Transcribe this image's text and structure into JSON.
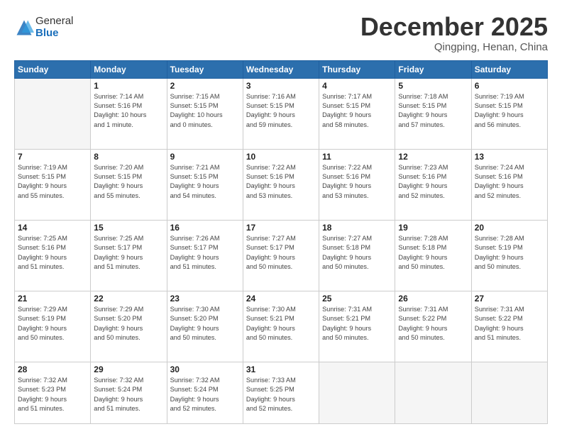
{
  "logo": {
    "general": "General",
    "blue": "Blue"
  },
  "header": {
    "month": "December 2025",
    "location": "Qingping, Henan, China"
  },
  "weekdays": [
    "Sunday",
    "Monday",
    "Tuesday",
    "Wednesday",
    "Thursday",
    "Friday",
    "Saturday"
  ],
  "weeks": [
    [
      {
        "day": "",
        "info": ""
      },
      {
        "day": "1",
        "info": "Sunrise: 7:14 AM\nSunset: 5:16 PM\nDaylight: 10 hours\nand 1 minute."
      },
      {
        "day": "2",
        "info": "Sunrise: 7:15 AM\nSunset: 5:15 PM\nDaylight: 10 hours\nand 0 minutes."
      },
      {
        "day": "3",
        "info": "Sunrise: 7:16 AM\nSunset: 5:15 PM\nDaylight: 9 hours\nand 59 minutes."
      },
      {
        "day": "4",
        "info": "Sunrise: 7:17 AM\nSunset: 5:15 PM\nDaylight: 9 hours\nand 58 minutes."
      },
      {
        "day": "5",
        "info": "Sunrise: 7:18 AM\nSunset: 5:15 PM\nDaylight: 9 hours\nand 57 minutes."
      },
      {
        "day": "6",
        "info": "Sunrise: 7:19 AM\nSunset: 5:15 PM\nDaylight: 9 hours\nand 56 minutes."
      }
    ],
    [
      {
        "day": "7",
        "info": "Sunrise: 7:19 AM\nSunset: 5:15 PM\nDaylight: 9 hours\nand 55 minutes."
      },
      {
        "day": "8",
        "info": "Sunrise: 7:20 AM\nSunset: 5:15 PM\nDaylight: 9 hours\nand 55 minutes."
      },
      {
        "day": "9",
        "info": "Sunrise: 7:21 AM\nSunset: 5:15 PM\nDaylight: 9 hours\nand 54 minutes."
      },
      {
        "day": "10",
        "info": "Sunrise: 7:22 AM\nSunset: 5:16 PM\nDaylight: 9 hours\nand 53 minutes."
      },
      {
        "day": "11",
        "info": "Sunrise: 7:22 AM\nSunset: 5:16 PM\nDaylight: 9 hours\nand 53 minutes."
      },
      {
        "day": "12",
        "info": "Sunrise: 7:23 AM\nSunset: 5:16 PM\nDaylight: 9 hours\nand 52 minutes."
      },
      {
        "day": "13",
        "info": "Sunrise: 7:24 AM\nSunset: 5:16 PM\nDaylight: 9 hours\nand 52 minutes."
      }
    ],
    [
      {
        "day": "14",
        "info": "Sunrise: 7:25 AM\nSunset: 5:16 PM\nDaylight: 9 hours\nand 51 minutes."
      },
      {
        "day": "15",
        "info": "Sunrise: 7:25 AM\nSunset: 5:17 PM\nDaylight: 9 hours\nand 51 minutes."
      },
      {
        "day": "16",
        "info": "Sunrise: 7:26 AM\nSunset: 5:17 PM\nDaylight: 9 hours\nand 51 minutes."
      },
      {
        "day": "17",
        "info": "Sunrise: 7:27 AM\nSunset: 5:17 PM\nDaylight: 9 hours\nand 50 minutes."
      },
      {
        "day": "18",
        "info": "Sunrise: 7:27 AM\nSunset: 5:18 PM\nDaylight: 9 hours\nand 50 minutes."
      },
      {
        "day": "19",
        "info": "Sunrise: 7:28 AM\nSunset: 5:18 PM\nDaylight: 9 hours\nand 50 minutes."
      },
      {
        "day": "20",
        "info": "Sunrise: 7:28 AM\nSunset: 5:19 PM\nDaylight: 9 hours\nand 50 minutes."
      }
    ],
    [
      {
        "day": "21",
        "info": "Sunrise: 7:29 AM\nSunset: 5:19 PM\nDaylight: 9 hours\nand 50 minutes."
      },
      {
        "day": "22",
        "info": "Sunrise: 7:29 AM\nSunset: 5:20 PM\nDaylight: 9 hours\nand 50 minutes."
      },
      {
        "day": "23",
        "info": "Sunrise: 7:30 AM\nSunset: 5:20 PM\nDaylight: 9 hours\nand 50 minutes."
      },
      {
        "day": "24",
        "info": "Sunrise: 7:30 AM\nSunset: 5:21 PM\nDaylight: 9 hours\nand 50 minutes."
      },
      {
        "day": "25",
        "info": "Sunrise: 7:31 AM\nSunset: 5:21 PM\nDaylight: 9 hours\nand 50 minutes."
      },
      {
        "day": "26",
        "info": "Sunrise: 7:31 AM\nSunset: 5:22 PM\nDaylight: 9 hours\nand 50 minutes."
      },
      {
        "day": "27",
        "info": "Sunrise: 7:31 AM\nSunset: 5:22 PM\nDaylight: 9 hours\nand 51 minutes."
      }
    ],
    [
      {
        "day": "28",
        "info": "Sunrise: 7:32 AM\nSunset: 5:23 PM\nDaylight: 9 hours\nand 51 minutes."
      },
      {
        "day": "29",
        "info": "Sunrise: 7:32 AM\nSunset: 5:24 PM\nDaylight: 9 hours\nand 51 minutes."
      },
      {
        "day": "30",
        "info": "Sunrise: 7:32 AM\nSunset: 5:24 PM\nDaylight: 9 hours\nand 52 minutes."
      },
      {
        "day": "31",
        "info": "Sunrise: 7:33 AM\nSunset: 5:25 PM\nDaylight: 9 hours\nand 52 minutes."
      },
      {
        "day": "",
        "info": ""
      },
      {
        "day": "",
        "info": ""
      },
      {
        "day": "",
        "info": ""
      }
    ]
  ]
}
